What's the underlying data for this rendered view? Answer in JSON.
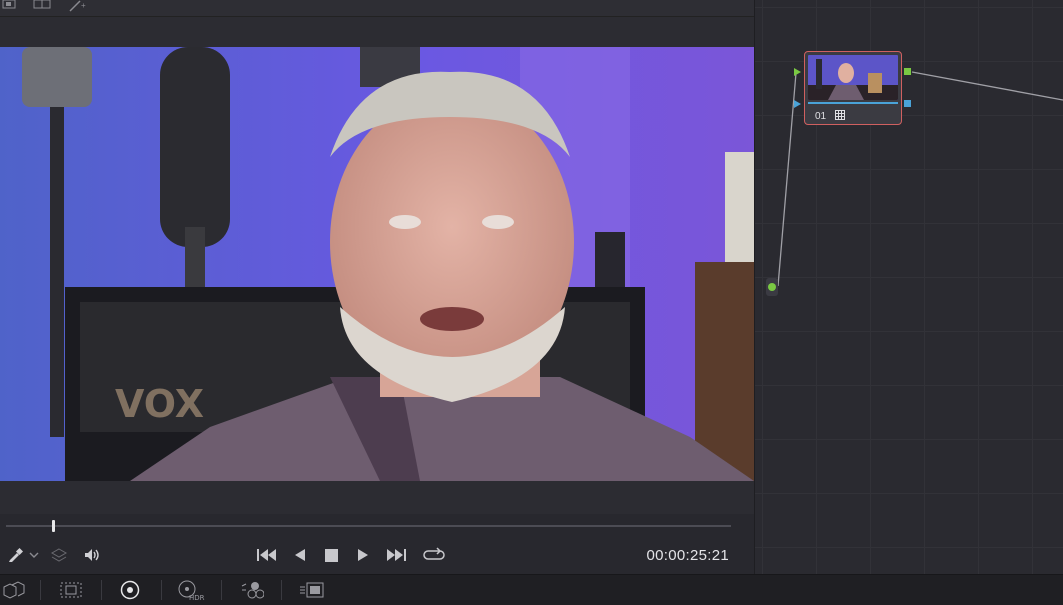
{
  "viewer": {
    "timecode": "00:00:25:21",
    "playhead_fraction": 0.065
  },
  "node_graph": {
    "nodes": [
      {
        "label": "01"
      }
    ]
  },
  "colors": {
    "accent_blue": "#4aa3d8",
    "node_border": "#d06060",
    "output_green": "#7ac943"
  },
  "icons": {
    "viewer_toolbar": [
      "layout-icon",
      "dual-view-icon",
      "magic-wand-icon"
    ],
    "transport_left": [
      "eyedropper-icon",
      "chevron-down-icon",
      "layers-icon",
      "speaker-icon"
    ],
    "transport": [
      "skip-to-start-icon",
      "play-reverse-icon",
      "stop-icon",
      "play-icon",
      "skip-to-end-icon",
      "loop-icon"
    ],
    "bottom_bar": [
      "3d-cubes-icon",
      "grid-select-icon",
      "color-wheels-icon",
      "hdr-wheels-icon",
      "rgb-mixer-icon",
      "motion-effects-icon"
    ]
  }
}
